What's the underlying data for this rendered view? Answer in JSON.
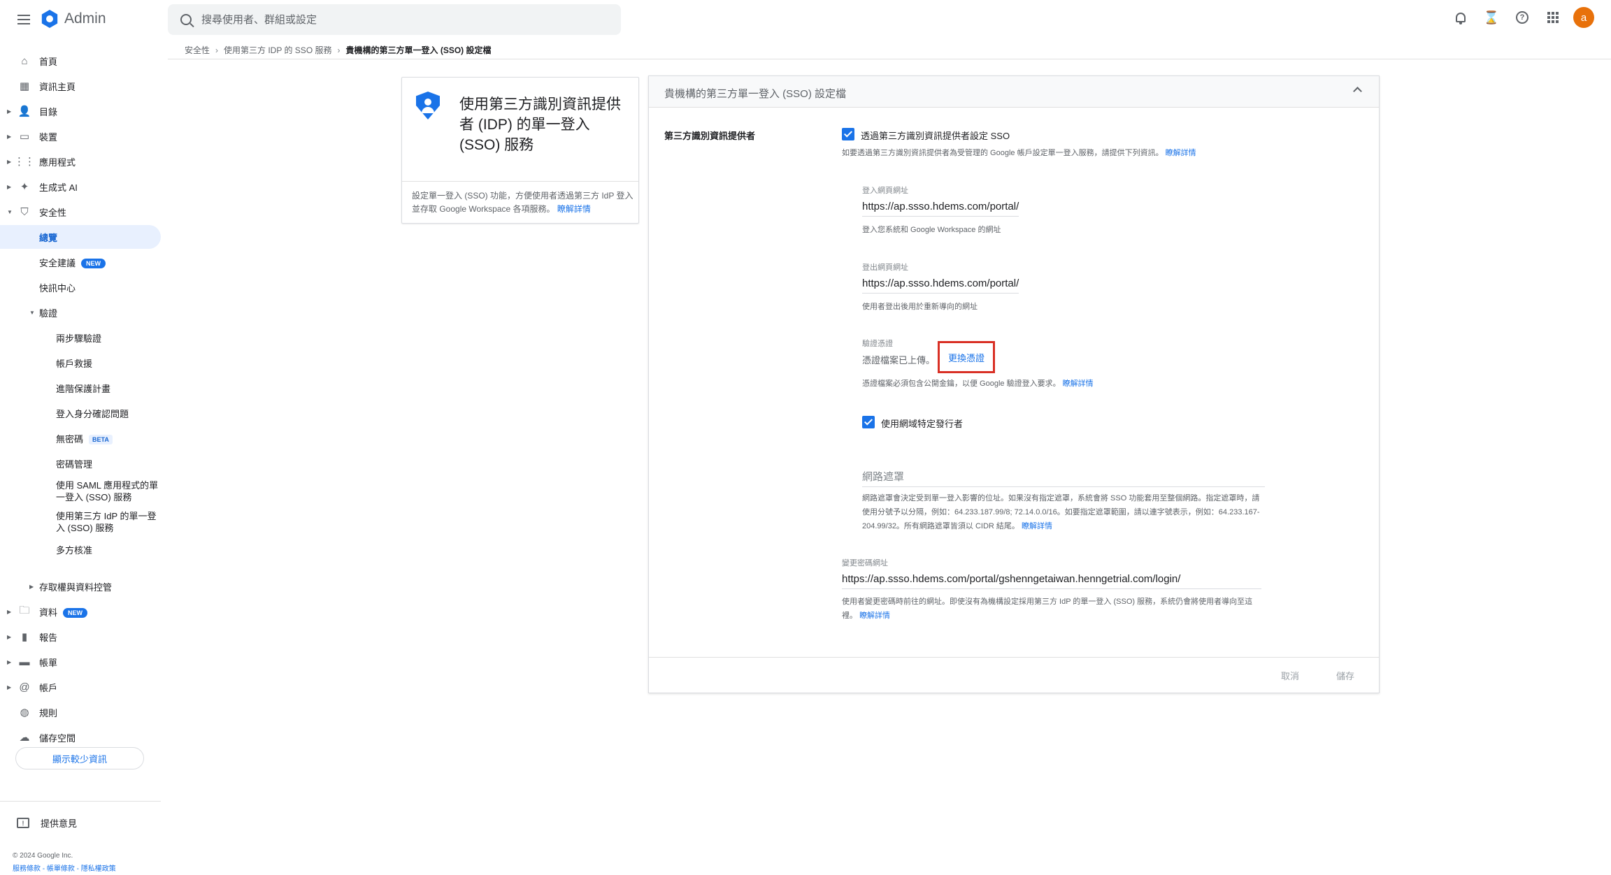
{
  "app": {
    "title": "Admin"
  },
  "search": {
    "placeholder": "搜尋使用者、群組或設定"
  },
  "user": {
    "avatar_letter": "a"
  },
  "sidebar": {
    "home": "首頁",
    "dashboard": "資訊主頁",
    "directory": "目錄",
    "devices": "裝置",
    "apps": "應用程式",
    "gen_ai": "生成式 AI",
    "security": "安全性",
    "overview": "總覽",
    "security_advice": "安全建議",
    "new_badge": "NEW",
    "alert_center": "快訊中心",
    "authentication": "驗證",
    "two_step": "兩步驟驗證",
    "account_recovery": "帳戶救援",
    "advanced_protection": "進階保護計畫",
    "login_challenges": "登入身分確認問題",
    "passwordless": "無密碼",
    "beta_badge": "BETA",
    "password_management": "密碼管理",
    "saml_sso": "使用 SAML 應用程式的單一登入 (SSO) 服務",
    "third_party_sso": "使用第三方 IdP 的單一登入 (SSO) 服務",
    "multi_party": "多方核准",
    "access_data_control": "存取權與資料控管",
    "data": "資料",
    "reports": "報告",
    "billing": "帳單",
    "account": "帳戶",
    "rules": "規則",
    "storage": "儲存空間",
    "show_less": "顯示較少資訊",
    "feedback": "提供意見",
    "copyright": "© 2024 Google Inc.",
    "footer_links": "服務條款 - 帳單條款 - 隱私權政策"
  },
  "breadcrumb": {
    "items": [
      "安全性",
      "使用第三方 IDP 的 SSO 服務"
    ],
    "current": "貴機構的第三方單一登入 (SSO) 設定檔"
  },
  "info_card": {
    "title": "使用第三方識別資訊提供者 (IDP) 的單一登入 (SSO) 服務",
    "description": "設定單一登入 (SSO) 功能，方便使用者透過第三方 IdP 登入並存取 Google Workspace 各項服務。",
    "learn_more": "瞭解詳情"
  },
  "panel": {
    "title": "貴機構的第三方單一登入 (SSO) 設定檔",
    "section_label": "第三方識別資訊提供者",
    "setup_sso_label": "透過第三方識別資訊提供者設定 SSO",
    "setup_sso_help": "如要透過第三方識別資訊提供者為受管理的 Google 帳戶設定單一登入服務，請提供下列資訊。",
    "learn_more": "瞭解詳情",
    "signin_label": "登入網頁網址",
    "signin_value": "https://ap.ssso.hdems.com/portal/",
    "signin_help": "登入您系統和 Google Workspace 的網址",
    "signout_label": "登出網頁網址",
    "signout_value": "https://ap.ssso.hdems.com/portal/",
    "signout_help": "使用者登出後用於重新導向的網址",
    "cert_label": "驗證憑證",
    "cert_status": "憑證檔案已上傳。",
    "replace_cert": "更換憑證",
    "cert_help": "憑證檔案必須包含公開金鑰，以便 Google 驗證登入要求。",
    "domain_issuer_label": "使用網域特定發行者",
    "network_mask_placeholder": "網路遮罩",
    "network_mask_help": "網路遮罩會決定受到單一登入影響的位址。如果沒有指定遮罩，系統會將 SSO 功能套用至整個網路。指定遮罩時，請使用分號予以分隔，例如：64.233.187.99/8; 72.14.0.0/16。如要指定遮罩範圍，請以連字號表示，例如：64.233.167-204.99/32。所有網路遮罩皆須以 CIDR 結尾。",
    "change_pw_label": "變更密碼網址",
    "change_pw_value": "https://ap.ssso.hdems.com/portal/gshenngetaiwan.henngetrial.com/login/",
    "change_pw_help": "使用者變更密碼時前往的網址。即使沒有為機構設定採用第三方 IdP 的單一登入 (SSO) 服務，系統仍會將使用者導向至這裡。",
    "cancel": "取消",
    "save": "儲存"
  }
}
